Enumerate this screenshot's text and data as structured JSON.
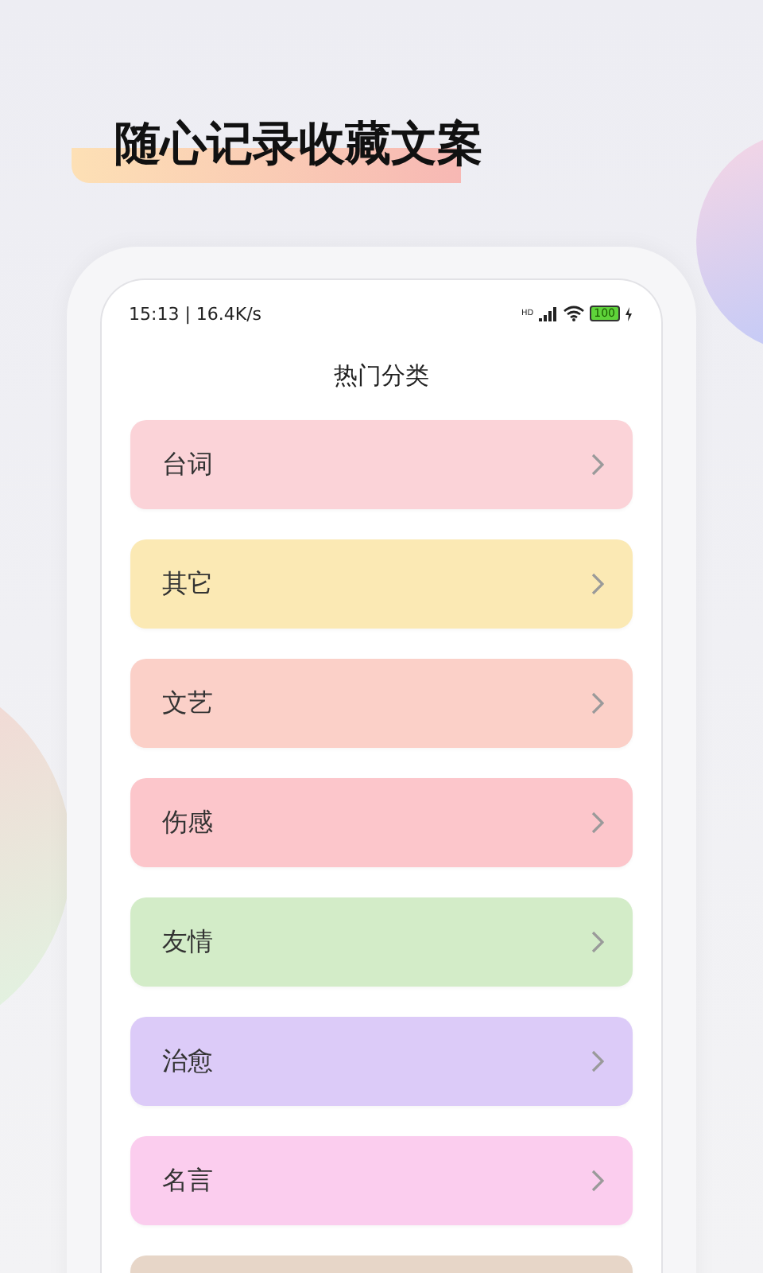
{
  "headline": "随心记录收藏文案",
  "status_bar": {
    "time_speed": "15:13 | 16.4K/s",
    "network": "HD",
    "battery": "100"
  },
  "title": "热门分类",
  "categories": [
    {
      "label": "台词",
      "color": "#fbd3d8"
    },
    {
      "label": "其它",
      "color": "#fbe9b4"
    },
    {
      "label": "文艺",
      "color": "#fbd0c8"
    },
    {
      "label": "伤感",
      "color": "#fcc6cb"
    },
    {
      "label": "友情",
      "color": "#d3ecc8"
    },
    {
      "label": "治愈",
      "color": "#dccbf8"
    },
    {
      "label": "名言",
      "color": "#fbcdee"
    },
    {
      "color": "#e7d6c8"
    }
  ]
}
